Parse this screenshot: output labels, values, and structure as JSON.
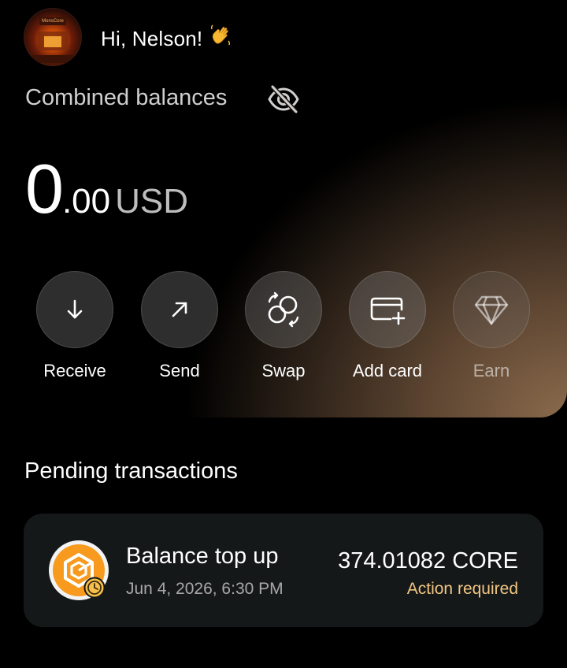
{
  "header": {
    "greeting": "Hi, Nelson!",
    "greeting_emoji": "👋",
    "avatar_text": "MonsCore"
  },
  "balance": {
    "label": "Combined balances",
    "integer": "0",
    "decimal": ".00",
    "currency": "USD",
    "visibility_icon": "eye-off-icon"
  },
  "actions": [
    {
      "label": "Receive",
      "icon": "arrow-down-icon"
    },
    {
      "label": "Send",
      "icon": "arrow-up-right-icon"
    },
    {
      "label": "Swap",
      "icon": "swap-icon"
    },
    {
      "label": "Add card",
      "icon": "card-plus-icon"
    },
    {
      "label": "Earn",
      "icon": "diamond-icon",
      "disabled": true
    }
  ],
  "pending": {
    "title": "Pending transactions",
    "items": [
      {
        "title": "Balance top up",
        "date": "Jun 4, 2026, 6:30 PM",
        "amount": "374.01082 CORE",
        "status": "Action required",
        "icon": "core-token-icon",
        "badge_icon": "clock-icon"
      }
    ]
  },
  "colors": {
    "background": "#000000",
    "card": "#151819",
    "accent_status": "#f1c683",
    "brand_orange": "#f79a1e"
  }
}
